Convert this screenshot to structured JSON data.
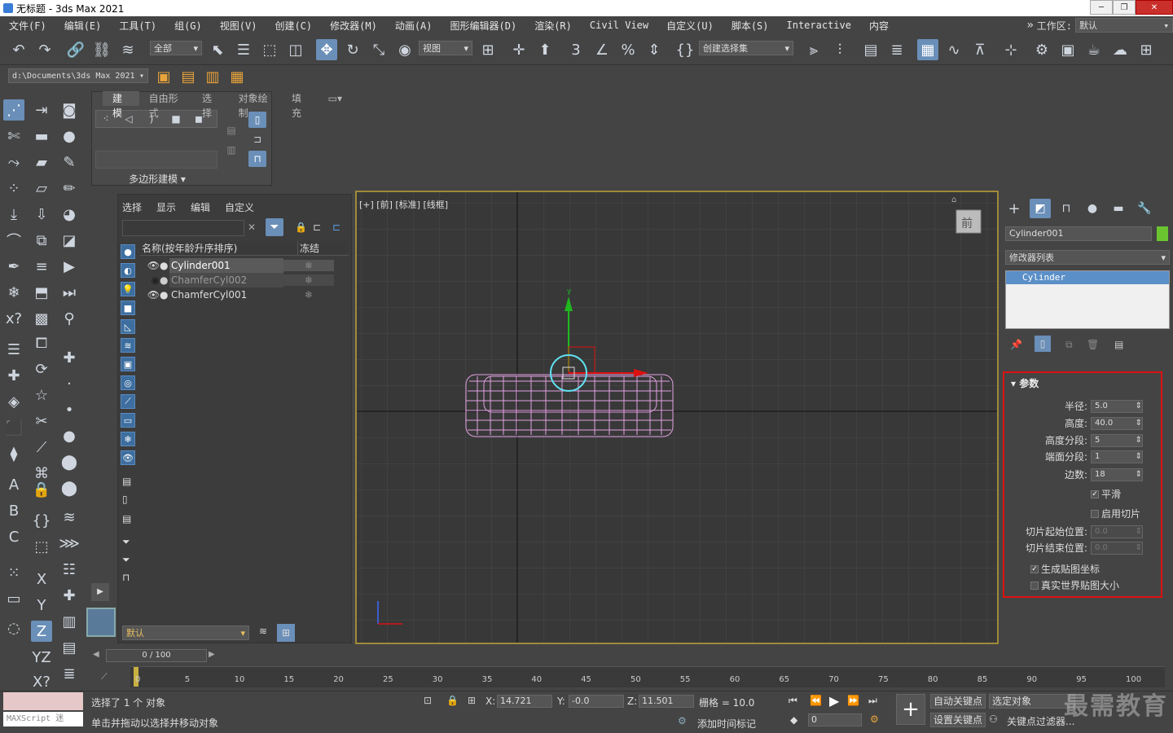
{
  "window": {
    "title": "无标题 - 3ds Max 2021"
  },
  "menu": {
    "items": [
      "文件(F)",
      "编辑(E)",
      "工具(T)",
      "组(G)",
      "视图(V)",
      "创建(C)",
      "修改器(M)",
      "动画(A)",
      "图形编辑器(D)",
      "渲染(R)",
      "Civil View",
      "自定义(U)",
      "脚本(S)",
      "Interactive",
      "内容"
    ],
    "workspace_label": "工作区:",
    "workspace_value": "默认"
  },
  "toolbar": {
    "selection_filter": "全部",
    "ref_coord": "视图",
    "named_selection": "创建选择集",
    "project_path": "d:\\Documents\\3ds Max 2021"
  },
  "ribbon": {
    "tabs": [
      "建模",
      "自由形式",
      "选择",
      "对象绘制",
      "填充"
    ],
    "panel_label": "多边形建模"
  },
  "scene_explorer": {
    "menu": [
      "选择",
      "显示",
      "编辑",
      "自定义"
    ],
    "col_name": "名称(按年龄升序排序)",
    "col_freeze": "冻结",
    "rows": [
      {
        "name": "Cylinder001",
        "selected": true
      },
      {
        "name": "ChamferCyl002",
        "selected": false
      },
      {
        "name": "ChamferCyl001",
        "selected": false
      }
    ],
    "layer_default": "默认"
  },
  "viewport": {
    "label": "[+] [前] [标准] [线框]",
    "viewcube_label": "前"
  },
  "command_panel": {
    "object_name": "Cylinder001",
    "object_color": "#6ac42f",
    "modifier_list": "修改器列表",
    "stack_item": "Cylinder",
    "rollout_title": "参数",
    "params": {
      "radius_label": "半径:",
      "radius": "5.0",
      "height_label": "高度:",
      "height": "40.0",
      "hseg_label": "高度分段:",
      "hseg": "5",
      "capseg_label": "端面分段:",
      "capseg": "1",
      "sides_label": "边数:",
      "sides": "18",
      "smooth_label": "平滑",
      "slice_label": "启用切片",
      "slice_from_label": "切片起始位置:",
      "slice_from": "0.0",
      "slice_to_label": "切片结束位置:",
      "slice_to": "0.0",
      "genmap_label": "生成贴图坐标",
      "realworld_label": "真实世界贴图大小"
    }
  },
  "timeline": {
    "slider": "0 / 100",
    "ticks": [
      "0",
      "5",
      "10",
      "15",
      "20",
      "25",
      "30",
      "35",
      "40",
      "45",
      "50",
      "55",
      "60",
      "65",
      "70",
      "75",
      "80",
      "85",
      "90",
      "95",
      "100"
    ]
  },
  "status": {
    "maxscript": "MAXScript 迷",
    "selected": "选择了 1 个 对象",
    "prompt": "单击并拖动以选择并移动对象",
    "x_label": "X:",
    "x": "14.721",
    "y_label": "Y:",
    "y": "-0.0",
    "z_label": "Z:",
    "z": "11.501",
    "grid": "栅格 = 10.0",
    "add_time_tag": "添加时间标记",
    "autokey": "自动关键点",
    "selected_obj": "选定对象",
    "setkey": "设置关键点",
    "key_filter": "关键点过滤器...",
    "frame": "0",
    "watermark": "最需教育"
  }
}
